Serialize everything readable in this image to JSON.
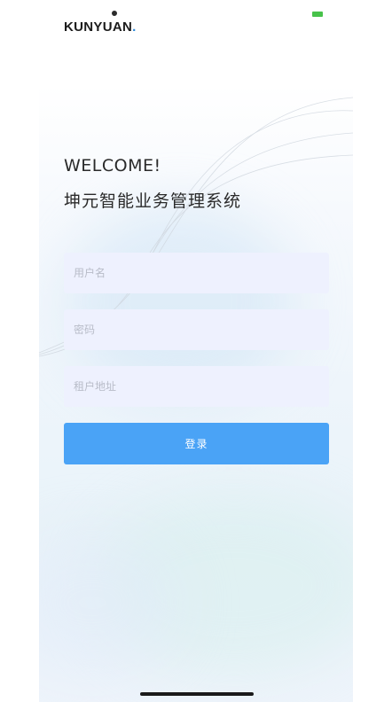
{
  "brand": {
    "logo_text": "KUNYUAN",
    "logo_period": "."
  },
  "status_bar": {
    "battery_color": "#47c24a"
  },
  "header": {
    "welcome": "WELCOME!",
    "system_name": "坤元智能业务管理系统"
  },
  "form": {
    "username_placeholder": "用户名",
    "password_placeholder": "密码",
    "tenant_placeholder": "租户地址",
    "login_label": "登录"
  },
  "colors": {
    "accent": "#4aa3f6",
    "field_bg": "#eef1fe",
    "text": "#2a2a2a"
  }
}
